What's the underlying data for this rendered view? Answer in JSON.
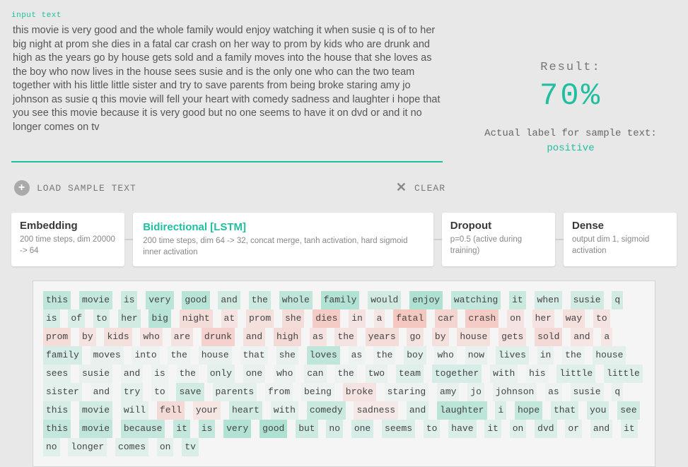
{
  "input": {
    "label": "input text",
    "text": "this movie is very good and the whole family would enjoy watching it when susie q is of to her big night at prom she dies in a fatal car crash on her way to prom by kids who are drunk and high as the years go by house gets sold and a family moves into the house that she loves as the boy who now lives in the house sees susie and is the only one who can the two team together with his little little sister and try to save parents from being broke staring amy jo johnson as susie q this movie will fell your heart with comedy sadness and laughter i hope that you see this movie because it is very good but no one seems to have it on dvd or and it no longer comes on tv"
  },
  "actions": {
    "load": "LOAD SAMPLE TEXT",
    "clear": "CLEAR"
  },
  "result": {
    "label": "Result:",
    "value": "70%",
    "actual_prefix": "Actual label for sample text:",
    "actual_value": "positive"
  },
  "pipeline": [
    {
      "name": "Embedding",
      "sub": "200 time steps, dim 20000 -> 64",
      "active": false
    },
    {
      "name": "Bidirectional [LSTM]",
      "sub": "200 time steps, dim 64 -> 32, concat merge, tanh activation, hard sigmoid inner activation",
      "active": true
    },
    {
      "name": "Dropout",
      "sub": "p=0.5 (active during training)",
      "active": false
    },
    {
      "name": "Dense",
      "sub": "output dim 1, sigmoid activation",
      "active": false
    }
  ],
  "tokens": [
    {
      "w": "this",
      "s": 0.6
    },
    {
      "w": "movie",
      "s": 0.55
    },
    {
      "w": "is",
      "s": 0.45
    },
    {
      "w": "very",
      "s": 0.65
    },
    {
      "w": "good",
      "s": 0.7
    },
    {
      "w": "and",
      "s": 0.4
    },
    {
      "w": "the",
      "s": 0.45
    },
    {
      "w": "whole",
      "s": 0.6
    },
    {
      "w": "family",
      "s": 0.75
    },
    {
      "w": "would",
      "s": 0.4
    },
    {
      "w": "enjoy",
      "s": 0.8
    },
    {
      "w": "watching",
      "s": 0.55
    },
    {
      "w": "it",
      "s": 0.5
    },
    {
      "w": "when",
      "s": 0.35
    },
    {
      "w": "susie",
      "s": 0.4
    },
    {
      "w": "q",
      "s": 0.4
    },
    {
      "w": "is",
      "s": 0.35
    },
    {
      "w": "of",
      "s": 0.3
    },
    {
      "w": "to",
      "s": 0.3
    },
    {
      "w": "her",
      "s": 0.4
    },
    {
      "w": "big",
      "s": 0.7
    },
    {
      "w": "night",
      "s": -0.4
    },
    {
      "w": "at",
      "s": -0.3
    },
    {
      "w": "prom",
      "s": -0.35
    },
    {
      "w": "she",
      "s": -0.4
    },
    {
      "w": "dies",
      "s": -0.7
    },
    {
      "w": "in",
      "s": -0.3
    },
    {
      "w": "a",
      "s": -0.25
    },
    {
      "w": "fatal",
      "s": -0.75
    },
    {
      "w": "car",
      "s": -0.55
    },
    {
      "w": "crash",
      "s": -0.7
    },
    {
      "w": "on",
      "s": -0.3
    },
    {
      "w": "her",
      "s": -0.3
    },
    {
      "w": "way",
      "s": -0.35
    },
    {
      "w": "to",
      "s": -0.3
    },
    {
      "w": "prom",
      "s": -0.4
    },
    {
      "w": "by",
      "s": -0.3
    },
    {
      "w": "kids",
      "s": -0.35
    },
    {
      "w": "who",
      "s": -0.3
    },
    {
      "w": "are",
      "s": -0.3
    },
    {
      "w": "drunk",
      "s": -0.6
    },
    {
      "w": "and",
      "s": -0.35
    },
    {
      "w": "high",
      "s": -0.45
    },
    {
      "w": "as",
      "s": -0.3
    },
    {
      "w": "the",
      "s": -0.3
    },
    {
      "w": "years",
      "s": -0.4
    },
    {
      "w": "go",
      "s": -0.3
    },
    {
      "w": "by",
      "s": -0.35
    },
    {
      "w": "house",
      "s": -0.35
    },
    {
      "w": "gets",
      "s": -0.3
    },
    {
      "w": "sold",
      "s": -0.45
    },
    {
      "w": "and",
      "s": -0.25
    },
    {
      "w": "a",
      "s": -0.25
    },
    {
      "w": "family",
      "s": 0.35
    },
    {
      "w": "moves",
      "s": 0.15
    },
    {
      "w": "into",
      "s": 0.1
    },
    {
      "w": "the",
      "s": 0.1
    },
    {
      "w": "house",
      "s": 0.15
    },
    {
      "w": "that",
      "s": 0.1
    },
    {
      "w": "she",
      "s": 0.15
    },
    {
      "w": "loves",
      "s": 0.6
    },
    {
      "w": "as",
      "s": 0.1
    },
    {
      "w": "the",
      "s": 0.1
    },
    {
      "w": "boy",
      "s": 0.2
    },
    {
      "w": "who",
      "s": 0.1
    },
    {
      "w": "now",
      "s": 0.15
    },
    {
      "w": "lives",
      "s": 0.25
    },
    {
      "w": "in",
      "s": 0.15
    },
    {
      "w": "the",
      "s": 0.1
    },
    {
      "w": "house",
      "s": 0.2
    },
    {
      "w": "sees",
      "s": 0.2
    },
    {
      "w": "susie",
      "s": 0.15
    },
    {
      "w": "and",
      "s": 0.1
    },
    {
      "w": "is",
      "s": 0.1
    },
    {
      "w": "the",
      "s": 0.1
    },
    {
      "w": "only",
      "s": 0.2
    },
    {
      "w": "one",
      "s": 0.15
    },
    {
      "w": "who",
      "s": 0.1
    },
    {
      "w": "can",
      "s": 0.15
    },
    {
      "w": "the",
      "s": 0.1
    },
    {
      "w": "two",
      "s": 0.15
    },
    {
      "w": "team",
      "s": 0.25
    },
    {
      "w": "together",
      "s": 0.35
    },
    {
      "w": "with",
      "s": 0.15
    },
    {
      "w": "his",
      "s": 0.1
    },
    {
      "w": "little",
      "s": 0.25
    },
    {
      "w": "little",
      "s": 0.25
    },
    {
      "w": "sister",
      "s": 0.2
    },
    {
      "w": "and",
      "s": 0.1
    },
    {
      "w": "try",
      "s": 0.2
    },
    {
      "w": "to",
      "s": 0.1
    },
    {
      "w": "save",
      "s": 0.4
    },
    {
      "w": "parents",
      "s": 0.2
    },
    {
      "w": "from",
      "s": 0.1
    },
    {
      "w": "being",
      "s": 0.1
    },
    {
      "w": "broke",
      "s": -0.3
    },
    {
      "w": "staring",
      "s": 0.1
    },
    {
      "w": "amy",
      "s": 0.15
    },
    {
      "w": "jo",
      "s": 0.15
    },
    {
      "w": "johnson",
      "s": 0.15
    },
    {
      "w": "as",
      "s": 0.1
    },
    {
      "w": "susie",
      "s": 0.15
    },
    {
      "w": "q",
      "s": 0.15
    },
    {
      "w": "this",
      "s": 0.35
    },
    {
      "w": "movie",
      "s": 0.4
    },
    {
      "w": "will",
      "s": 0.2
    },
    {
      "w": "fell",
      "s": -0.45
    },
    {
      "w": "your",
      "s": -0.25
    },
    {
      "w": "heart",
      "s": 0.4
    },
    {
      "w": "with",
      "s": 0.2
    },
    {
      "w": "comedy",
      "s": 0.5
    },
    {
      "w": "sadness",
      "s": -0.2
    },
    {
      "w": "and",
      "s": 0.25
    },
    {
      "w": "laughter",
      "s": 0.65
    },
    {
      "w": "i",
      "s": 0.3
    },
    {
      "w": "hope",
      "s": 0.55
    },
    {
      "w": "that",
      "s": 0.3
    },
    {
      "w": "you",
      "s": 0.35
    },
    {
      "w": "see",
      "s": 0.4
    },
    {
      "w": "this",
      "s": 0.55
    },
    {
      "w": "movie",
      "s": 0.6
    },
    {
      "w": "because",
      "s": 0.55
    },
    {
      "w": "it",
      "s": 0.55
    },
    {
      "w": "is",
      "s": 0.55
    },
    {
      "w": "very",
      "s": 0.75
    },
    {
      "w": "good",
      "s": 0.8
    },
    {
      "w": "but",
      "s": 0.45
    },
    {
      "w": "no",
      "s": 0.35
    },
    {
      "w": "one",
      "s": 0.35
    },
    {
      "w": "seems",
      "s": 0.3
    },
    {
      "w": "to",
      "s": 0.25
    },
    {
      "w": "have",
      "s": 0.3
    },
    {
      "w": "it",
      "s": 0.25
    },
    {
      "w": "on",
      "s": 0.25
    },
    {
      "w": "dvd",
      "s": 0.3
    },
    {
      "w": "or",
      "s": 0.2
    },
    {
      "w": "and",
      "s": 0.2
    },
    {
      "w": "it",
      "s": 0.25
    },
    {
      "w": "no",
      "s": 0.25
    },
    {
      "w": "longer",
      "s": 0.2
    },
    {
      "w": "comes",
      "s": 0.25
    },
    {
      "w": "on",
      "s": 0.2
    },
    {
      "w": "tv",
      "s": 0.3
    }
  ],
  "colors": {
    "accent": "#1fbfa0",
    "positive": "#9cdcc9",
    "negative": "#f3b9b0"
  }
}
